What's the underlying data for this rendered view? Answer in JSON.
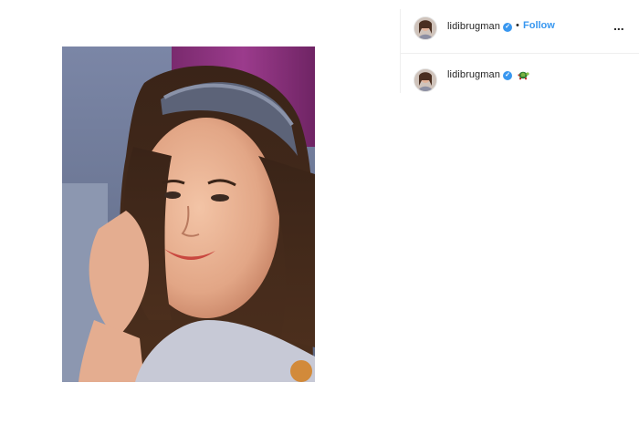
{
  "post": {
    "photo_alt": "selfie-photo",
    "header": {
      "username": "lidibrugman",
      "verified_mark": "✓",
      "separator": "•",
      "follow_label": "Follow",
      "more_label": "..."
    },
    "caption": {
      "username": "lidibrugman",
      "verified_mark": "✓",
      "emoji": "turtle-emoji"
    }
  },
  "colors": {
    "accent": "#3897f0",
    "text": "#262626",
    "divider": "#efefef"
  }
}
